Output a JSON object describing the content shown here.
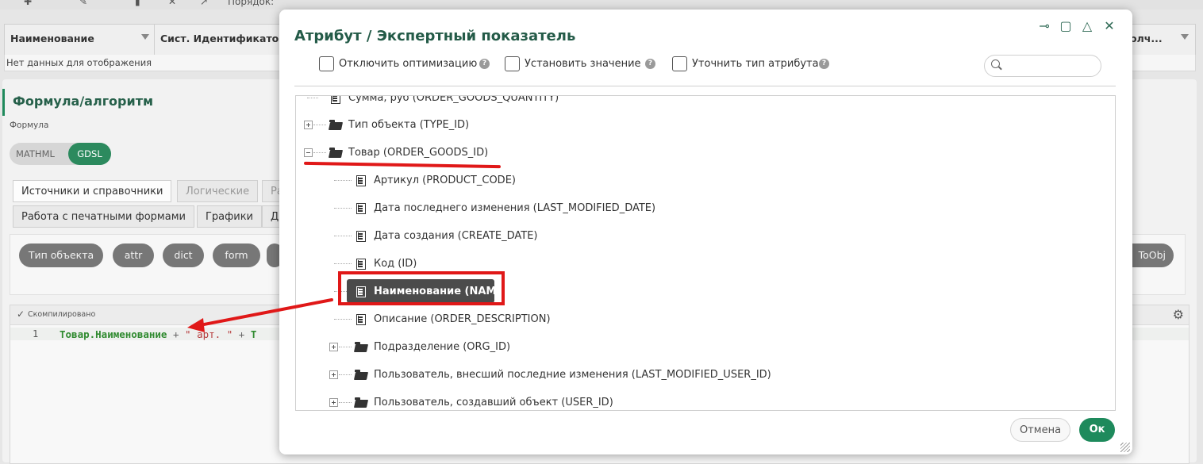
{
  "background": {
    "toolbar_label": "Порядок:",
    "grid": {
      "columns": [
        "Наименование",
        "Сист. Идентификатор",
        "олч..."
      ],
      "empty_text": "Нет данных для отображения"
    },
    "panel_title": "Формула/алгоритм",
    "formula_label": "Формула",
    "segments": [
      "MATHML",
      "GDSL"
    ],
    "tabs_row1": [
      "Источники и справочники",
      "Логические",
      "Ра"
    ],
    "tabs_row2": [
      "Работа с печатными формами",
      "Графики",
      "Д"
    ],
    "chips": [
      "Тип объекта",
      "attr",
      "dict",
      "form",
      "ToObj"
    ],
    "editor": {
      "status": "Скомпилировано",
      "line_number": "1",
      "code_var": "Товар.Наименование",
      "code_op1": " + ",
      "code_str": "\" арт. \"",
      "code_op2": " + ",
      "code_tail": "Т"
    }
  },
  "dialog": {
    "title": "Атрибут / Экспертный показатель",
    "options": [
      {
        "label": "Отключить оптимизацию",
        "checked": false
      },
      {
        "label": "Установить значение",
        "checked": false
      },
      {
        "label": "Уточнить тип атрибута",
        "checked": false
      }
    ],
    "help_glyph": "?",
    "search_placeholder": "",
    "tree": [
      {
        "label": "Сумма, руб (ORDER_GOODS_QUANTITY)",
        "kind": "doc"
      },
      {
        "label": "Тип объекта (TYPE_ID)",
        "kind": "folder",
        "expander": "plus"
      },
      {
        "label": "Товар (ORDER_GOODS_ID)",
        "kind": "folder",
        "expander": "minus"
      },
      {
        "label": "Артикул (PRODUCT_CODE)",
        "kind": "doc"
      },
      {
        "label": "Дата последнего изменения (LAST_MODIFIED_DATE)",
        "kind": "doc"
      },
      {
        "label": "Дата создания (CREATE_DATE)",
        "kind": "doc"
      },
      {
        "label": "Код (ID)",
        "kind": "doc"
      },
      {
        "label": "Наименование (NAME)",
        "kind": "doc",
        "selected": true
      },
      {
        "label": "Описание (ORDER_DESCRIPTION)",
        "kind": "doc"
      },
      {
        "label": "Подразделение (ORG_ID)",
        "kind": "folder",
        "expander": "plus"
      },
      {
        "label": "Пользователь, внесший последние изменения (LAST_MODIFIED_USER_ID)",
        "kind": "folder",
        "expander": "plus"
      },
      {
        "label": "Пользователь, создавший объект (USER_ID)",
        "kind": "folder",
        "expander": "plus"
      }
    ],
    "cancel_label": "Отмена",
    "ok_label": "Ок"
  },
  "colors": {
    "accent": "#1e8a5c",
    "title": "#245b48",
    "annotation": "#e01818",
    "selected_row": "#4b4b4b"
  }
}
